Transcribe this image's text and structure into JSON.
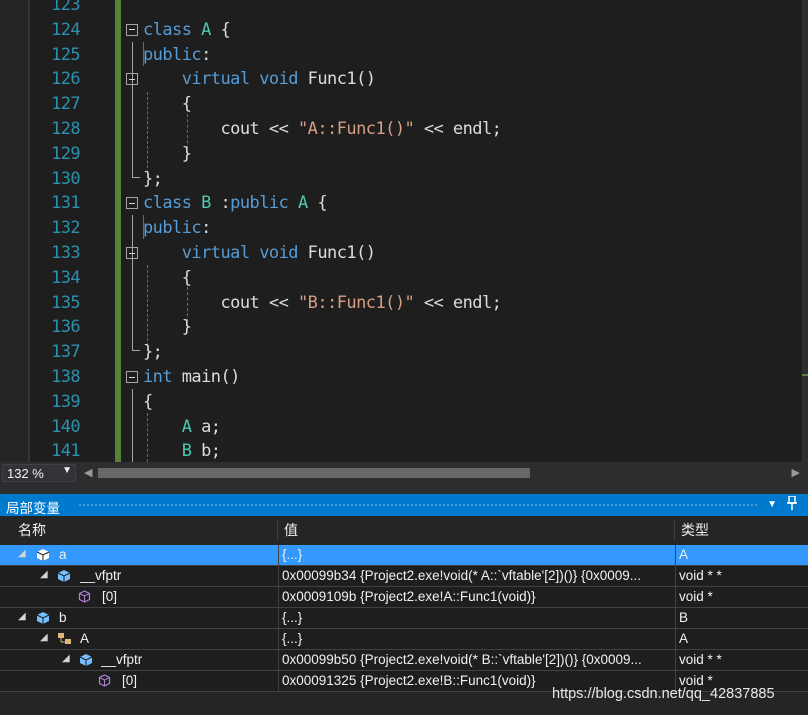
{
  "editor": {
    "lines": [
      {
        "num": "123",
        "tokens": []
      },
      {
        "num": "124",
        "tokens": [
          {
            "t": "class ",
            "c": "kw"
          },
          {
            "t": "A",
            "c": "ty"
          },
          {
            "t": " {",
            "c": ""
          }
        ]
      },
      {
        "num": "125",
        "tokens": [
          {
            "t": "public",
            "c": "kw"
          },
          {
            "t": ":",
            "c": ""
          }
        ]
      },
      {
        "num": "126",
        "tokens": [
          {
            "t": "    virtual ",
            "c": "kw"
          },
          {
            "t": "void ",
            "c": "kw"
          },
          {
            "t": "Func1()",
            "c": ""
          }
        ]
      },
      {
        "num": "127",
        "tokens": [
          {
            "t": "    {",
            "c": ""
          }
        ]
      },
      {
        "num": "128",
        "tokens": [
          {
            "t": "        cout << ",
            "c": ""
          },
          {
            "t": "\"A::Func1()\"",
            "c": "st"
          },
          {
            "t": " << endl;",
            "c": ""
          }
        ]
      },
      {
        "num": "129",
        "tokens": [
          {
            "t": "    }",
            "c": ""
          }
        ]
      },
      {
        "num": "130",
        "tokens": [
          {
            "t": "};",
            "c": ""
          }
        ]
      },
      {
        "num": "131",
        "tokens": [
          {
            "t": "class ",
            "c": "kw"
          },
          {
            "t": "B ",
            "c": "ty"
          },
          {
            "t": ":",
            "c": ""
          },
          {
            "t": "public ",
            "c": "kw"
          },
          {
            "t": "A",
            "c": "ty"
          },
          {
            "t": " {",
            "c": ""
          }
        ]
      },
      {
        "num": "132",
        "tokens": [
          {
            "t": "public",
            "c": "kw"
          },
          {
            "t": ":",
            "c": ""
          }
        ]
      },
      {
        "num": "133",
        "tokens": [
          {
            "t": "    virtual ",
            "c": "kw"
          },
          {
            "t": "void ",
            "c": "kw"
          },
          {
            "t": "Func1()",
            "c": ""
          }
        ]
      },
      {
        "num": "134",
        "tokens": [
          {
            "t": "    {",
            "c": ""
          }
        ]
      },
      {
        "num": "135",
        "tokens": [
          {
            "t": "        cout << ",
            "c": ""
          },
          {
            "t": "\"B::Func1()\"",
            "c": "st"
          },
          {
            "t": " << endl;",
            "c": ""
          }
        ]
      },
      {
        "num": "136",
        "tokens": [
          {
            "t": "    }",
            "c": ""
          }
        ]
      },
      {
        "num": "137",
        "tokens": [
          {
            "t": "};",
            "c": ""
          }
        ]
      },
      {
        "num": "138",
        "tokens": [
          {
            "t": "int ",
            "c": "kw"
          },
          {
            "t": "main()",
            "c": ""
          }
        ]
      },
      {
        "num": "139",
        "tokens": [
          {
            "t": "{",
            "c": ""
          }
        ]
      },
      {
        "num": "140",
        "tokens": [
          {
            "t": "    ",
            "c": ""
          },
          {
            "t": "A ",
            "c": "ty"
          },
          {
            "t": "a;",
            "c": ""
          }
        ]
      },
      {
        "num": "141",
        "tokens": [
          {
            "t": "    ",
            "c": ""
          },
          {
            "t": "B ",
            "c": "ty"
          },
          {
            "t": "b;",
            "c": ""
          }
        ]
      }
    ]
  },
  "status": {
    "zoom": "132 %"
  },
  "locals": {
    "title": "局部变量",
    "columns": {
      "name": "名称",
      "value": "值",
      "type": "类型"
    },
    "rows": [
      {
        "name": "a",
        "value": "{...}",
        "type": "A"
      },
      {
        "name": "__vfptr",
        "value": "0x00099b34 {Project2.exe!void(* A::`vftable'[2])()} {0x0009...",
        "type": "void * *"
      },
      {
        "name": "[0]",
        "value": "0x0009109b {Project2.exe!A::Func1(void)}",
        "type": "void *"
      },
      {
        "name": "b",
        "value": "{...}",
        "type": "B"
      },
      {
        "name": "A",
        "value": "{...}",
        "type": "A"
      },
      {
        "name": "__vfptr",
        "value": "0x00099b50 {Project2.exe!void(* B::`vftable'[2])()} {0x0009...",
        "type": "void * *"
      },
      {
        "name": "[0]",
        "value": "0x00091325 {Project2.exe!B::Func1(void)}",
        "type": "void *"
      }
    ]
  },
  "watermark": "https://blog.csdn.net/qq_42837885",
  "colors": {
    "keyword": "#569cd6",
    "type": "#4ec9b0",
    "string": "#d69d85",
    "line_number": "#2b91af",
    "accent": "#007acc",
    "selection": "#3399ff",
    "change_bar": "#57803a"
  },
  "icons": [
    "collapse-box-icon",
    "expand-triangle-icon",
    "object-cube-icon",
    "pointer-cube-icon",
    "base-class-icon",
    "dropdown-arrow-icon",
    "scroll-left-arrow-icon",
    "scroll-right-arrow-icon",
    "dropdown-caret-icon",
    "pin-icon"
  ]
}
